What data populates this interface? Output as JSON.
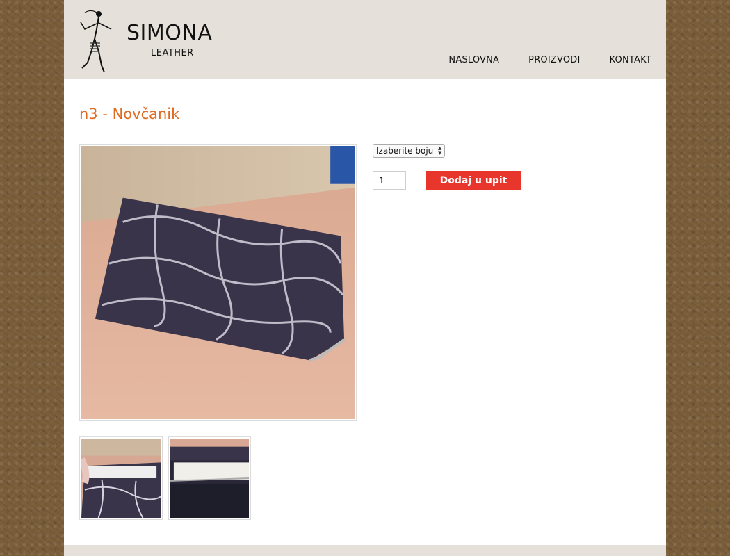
{
  "brand": {
    "name": "SIMONA",
    "tagline": "LEATHER"
  },
  "nav": {
    "items": [
      "NASLOVNA",
      "PROIZVODI",
      "KONTAKT"
    ]
  },
  "product": {
    "title": "n3 - Novčanik",
    "color_select": {
      "selected": "Izaberite boju"
    },
    "quantity": "1",
    "add_button": "Dodaj u upit"
  },
  "colors": {
    "title": "#e0691f",
    "button": "#e8362d",
    "header_bg": "#e5e1da"
  }
}
